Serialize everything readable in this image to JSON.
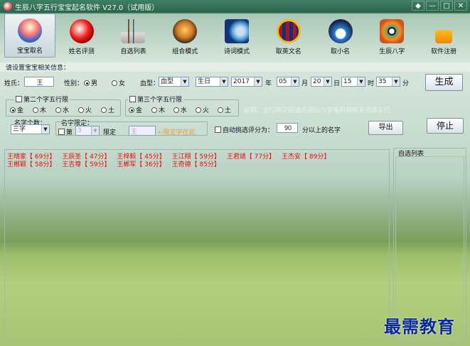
{
  "window": {
    "title": "生辰八字五行宝宝起名软件 V27.0（试用版）",
    "buttons": [
      "◆",
      "—",
      "□",
      "✕"
    ]
  },
  "toolbar": {
    "items": [
      {
        "label": "宝宝取名",
        "icon": "baby-doll-icon",
        "active": true
      },
      {
        "label": "姓名评测",
        "icon": "dragon-ball-icon",
        "active": false
      },
      {
        "label": "自选列表",
        "icon": "brush-pot-icon",
        "active": false
      },
      {
        "label": "组合模式",
        "icon": "tiger-icon",
        "active": false
      },
      {
        "label": "诗词模式",
        "icon": "book-cd-icon",
        "active": false
      },
      {
        "label": "取英文名",
        "icon": "barcelona-emblem-icon",
        "active": false
      },
      {
        "label": "取小名",
        "icon": "penguin-icon",
        "active": false
      },
      {
        "label": "生辰八字",
        "icon": "bagua-icon",
        "active": false
      },
      {
        "label": "软件注册",
        "icon": "lock-icon",
        "active": false
      }
    ]
  },
  "form": {
    "section_title": "请设置宝宝相关信息：",
    "surname_label": "姓氏：",
    "surname_value": "王",
    "gender_label": "性别：",
    "gender_male": "男",
    "gender_female": "女",
    "blood_label": "血型：",
    "blood_value": "血型",
    "birth_type": "生日",
    "year": "2017",
    "year_unit": "年",
    "month": "05",
    "month_unit": "月",
    "day": "20",
    "day_unit": "日",
    "hour": "15",
    "hour_unit": "时",
    "minute": "35",
    "minute_unit": "分",
    "generate_button": "生成",
    "second_char_label": "第二个字五行限",
    "third_char_label": "第三个字五行限",
    "elements": [
      "金",
      "木",
      "水",
      "火",
      "土"
    ],
    "hint_text": "说明：五行限定前请先测出八字喜用神再来选择五行",
    "char_count_label": "名字个数：",
    "char_count_value": "三字",
    "name_limit_label": "名字限定：",
    "limit_position_label": "第",
    "limit_position_value": "3",
    "limit_word_label": "限定",
    "limit_word_value": "王",
    "limit_note": "←限定字在此",
    "auto_pick_label": "自动挑选评分为：",
    "auto_pick_value": "90",
    "auto_pick_unit": "分以上的名字",
    "export_button": "导出",
    "stop_button": "停止"
  },
  "results": {
    "rows": [
      [
        "王晴家【 69分】",
        "王辰圣【 47分】",
        "王梓毅【 45分】",
        "王江翔【 59分】",
        "王君靖【 77分】",
        "王杰安【 89分】"
      ],
      [
        "王郴颖【 58分】",
        "王吉尊【 59分】",
        "王郴军【 36分】",
        "王奇德【 85分】"
      ]
    ]
  },
  "side": {
    "title": "自选列表"
  },
  "watermark": "最需教育"
}
